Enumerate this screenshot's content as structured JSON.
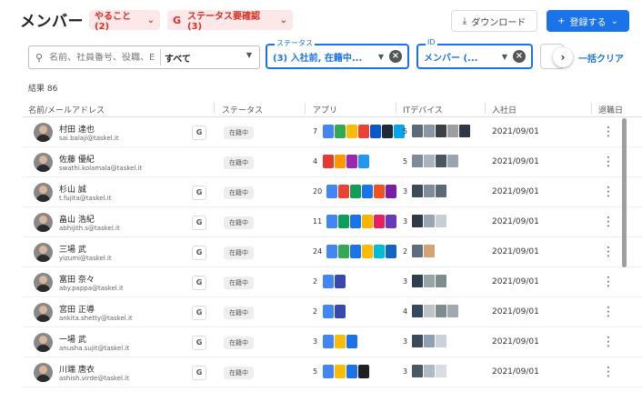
{
  "header": {
    "title": "メンバー",
    "todo_chip": "やること (2)",
    "status_chip_icon": "G",
    "status_chip": "ステータス要確認 (3)",
    "download_label": "ダウンロード",
    "register_label": "登録する"
  },
  "filters": {
    "search_placeholder": "名前、社員番号、役職、E",
    "scope_value": "すべて",
    "status_legend": "ステータス",
    "status_value": "(3) 入社前, 在籍中...",
    "id_legend": "ID",
    "id_value": "メンバー (...",
    "clear_all": "一括クリア"
  },
  "result_count": "結果 86",
  "table": {
    "columns": [
      "名前/メールアドレス",
      "ステータス",
      "アプリ",
      "ITデバイス",
      "入社日",
      "退職日"
    ],
    "rows": [
      {
        "name": "村田 達也",
        "email": "sai.balaji@taskel.it",
        "google": "G",
        "status": "在籍中",
        "apps_count": "7",
        "devices_count": "5",
        "joined": "2021/09/01"
      },
      {
        "name": "佐藤 優紀",
        "email": "swathi.kolamala@taskel.it",
        "google": "",
        "status": "在籍中",
        "apps_count": "4",
        "devices_count": "5",
        "joined": "2021/09/01"
      },
      {
        "name": "杉山 誠",
        "email": "t.fujita@taskel.it",
        "google": "G",
        "status": "在籍中",
        "apps_count": "20",
        "devices_count": "3",
        "joined": "2021/09/01"
      },
      {
        "name": "畠山 浩紀",
        "email": "abhijith.s@taskel.it",
        "google": "G",
        "status": "在籍中",
        "apps_count": "11",
        "devices_count": "3",
        "joined": "2021/09/01"
      },
      {
        "name": "三場 武",
        "email": "yizumi@taskel.it",
        "google": "G",
        "status": "在籍中",
        "apps_count": "24",
        "devices_count": "2",
        "joined": "2021/09/01"
      },
      {
        "name": "富田 奈々",
        "email": "aby.pappa@taskel.it",
        "google": "G",
        "status": "在籍中",
        "apps_count": "2",
        "devices_count": "3",
        "joined": "2021/09/01"
      },
      {
        "name": "宮田 正導",
        "email": "ankita.shetty@taskel.it",
        "google": "G",
        "status": "在籍中",
        "apps_count": "2",
        "devices_count": "4",
        "joined": "2021/09/01"
      },
      {
        "name": "一場 武",
        "email": "anusha.sujit@taskel.it",
        "google": "G",
        "status": "在籍中",
        "apps_count": "3",
        "devices_count": "3",
        "joined": "2021/09/01"
      },
      {
        "name": "川端 唐衣",
        "email": "ashish.virde@taskel.it",
        "google": "G",
        "status": "在籍中",
        "apps_count": "5",
        "devices_count": "3",
        "joined": "2021/09/01"
      }
    ]
  },
  "icons": {
    "search": "search-icon",
    "download": "download-icon",
    "add": "plus-icon",
    "dropdown": "chevron-down-icon",
    "more": "chevron-right-icon",
    "row_menu": "kebab-icon"
  },
  "colors": {
    "accent": "#1a73e8",
    "alert": "#d93025",
    "alert_bg": "#fce8e8"
  }
}
